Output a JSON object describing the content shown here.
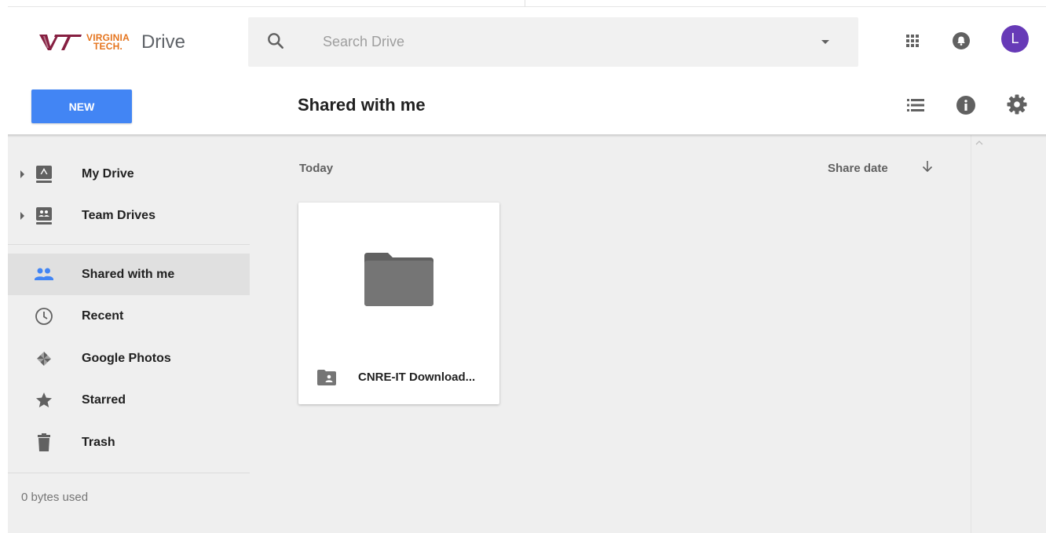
{
  "header": {
    "logo_line1": "VIRGINIA",
    "logo_line2": "TECH.",
    "product": "Drive",
    "search": {
      "placeholder": "Search Drive",
      "value": ""
    },
    "avatar_initial": "L"
  },
  "toolbar": {
    "new_label": "NEW",
    "page_title": "Shared with me"
  },
  "sidebar": {
    "items": [
      {
        "label": "My Drive",
        "icon": "drive-icon",
        "expandable": true
      },
      {
        "label": "Team Drives",
        "icon": "team-drives-icon",
        "expandable": true
      },
      {
        "label": "Shared with me",
        "icon": "people-icon",
        "active": true
      },
      {
        "label": "Recent",
        "icon": "clock-icon"
      },
      {
        "label": "Google Photos",
        "icon": "pinwheel-icon"
      },
      {
        "label": "Starred",
        "icon": "star-icon"
      },
      {
        "label": "Trash",
        "icon": "trash-icon"
      }
    ],
    "storage": "0 bytes used"
  },
  "main": {
    "section": "Today",
    "sort_label": "Share date",
    "sort_direction": "descending",
    "files": [
      {
        "name": "CNRE-IT Download...",
        "type": "shared-folder"
      }
    ]
  },
  "colors": {
    "accent": "#4285f4",
    "brand_orange": "#e5751f",
    "brand_maroon": "#861f41",
    "avatar": "#673ab7",
    "content_bg": "#efefef",
    "active_item": "#e0e0e0"
  }
}
